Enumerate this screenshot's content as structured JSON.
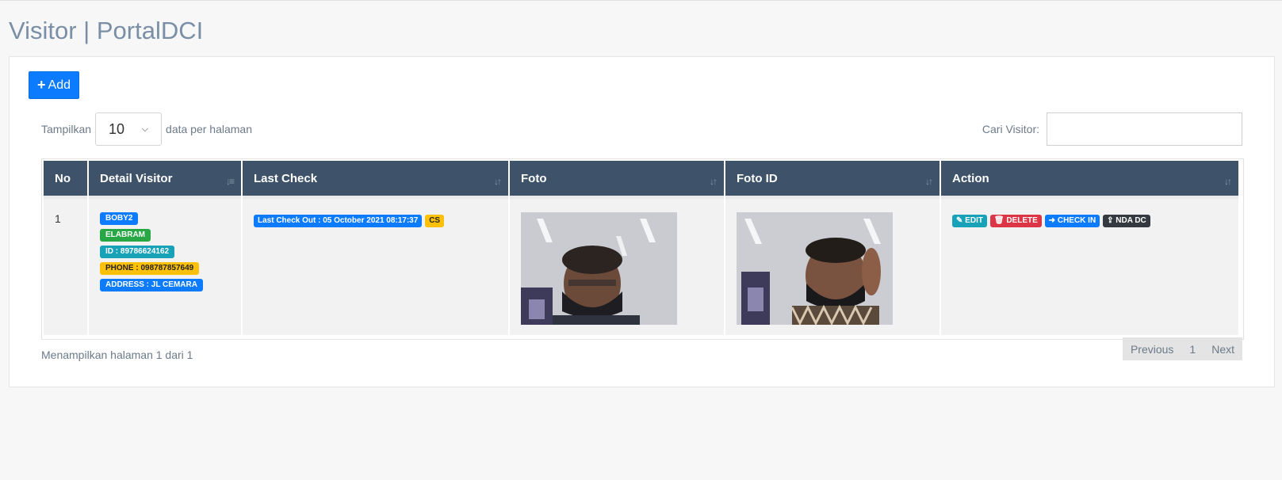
{
  "page": {
    "title": "Visitor | PortalDCI"
  },
  "toolbar": {
    "add_icon": "plus-icon",
    "add_label": "Add"
  },
  "length": {
    "prefix": "Tampilkan",
    "value": "10",
    "suffix": "data per halaman"
  },
  "search": {
    "label": "Cari Visitor:",
    "value": "",
    "placeholder": ""
  },
  "table": {
    "headers": [
      "No",
      "Detail Visitor",
      "Last Check",
      "Foto",
      "Foto ID",
      "Action"
    ],
    "rows": [
      {
        "no": "1",
        "detail": {
          "name": "BOBY2",
          "company": "ELABRAM",
          "id": "ID : 89786624162",
          "phone": "PHONE : 098787857649",
          "address": "ADDRESS : JL CEMARA"
        },
        "last_check": {
          "text": "Last Check Out : 05 October 2021 08:17:37",
          "tag": "CS"
        },
        "actions": {
          "edit": "EDIT",
          "delete": "DELETE",
          "checkin": "CHECK IN",
          "nda": "NDA DC"
        }
      }
    ]
  },
  "footer": {
    "info": "Menampilkan halaman 1 dari 1"
  },
  "pagination": {
    "previous": "Previous",
    "page": "1",
    "next": "Next"
  },
  "colors": {
    "header_bg": "#3e5369",
    "primary": "#0d7bfe",
    "success": "#28a745",
    "info": "#17a2b8",
    "warning": "#ffc107",
    "danger": "#dc3545",
    "dark": "#343a40"
  }
}
